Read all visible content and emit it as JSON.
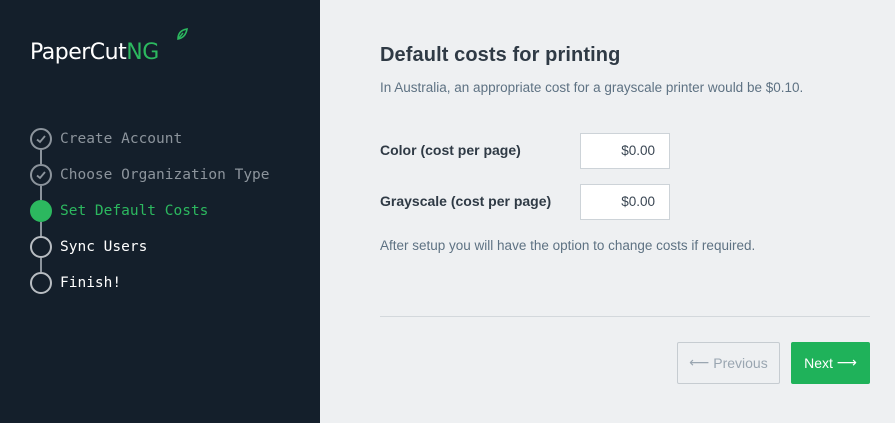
{
  "sidebar": {
    "logo": {
      "text_main": "PaperCut",
      "text_accent": "NG"
    },
    "steps": [
      {
        "label": "Create Account",
        "state": "done"
      },
      {
        "label": "Choose Organization Type",
        "state": "done"
      },
      {
        "label": "Set Default Costs",
        "state": "active"
      },
      {
        "label": "Sync Users",
        "state": "pending"
      },
      {
        "label": "Finish!",
        "state": "pending"
      }
    ]
  },
  "main": {
    "title": "Default costs for printing",
    "subtitle": "In Australia, an appropriate cost for a grayscale printer would be $0.10.",
    "fields": [
      {
        "label": "Color (cost per page)",
        "value": "$0.00"
      },
      {
        "label": "Grayscale (cost per page)",
        "value": "$0.00"
      }
    ],
    "note": "After setup you will have the option to change costs if required.",
    "buttons": {
      "previous": "Previous",
      "next": "Next"
    }
  },
  "colors": {
    "sidebar_bg": "#141f2b",
    "accent_green": "#2cb85f",
    "main_bg": "#eef0f2"
  }
}
